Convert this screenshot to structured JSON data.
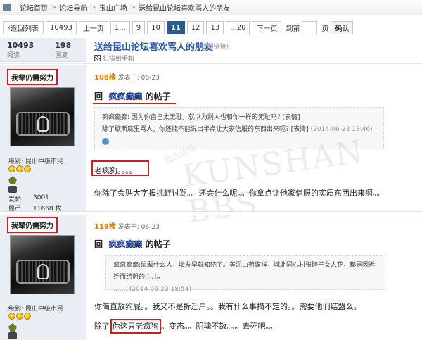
{
  "breadcrumb": {
    "items": [
      "论坛首页",
      "论坛导航",
      "玉山广场",
      "送给昆山论坛喜欢骂人的朋友"
    ],
    "sep": ">"
  },
  "pager": {
    "back": "返回列表",
    "total": "10493",
    "prev": "上一页",
    "pages": [
      "1...",
      "9",
      "10",
      "11",
      "12",
      "13",
      "...20"
    ],
    "current": "11",
    "next": "下一页",
    "jump_label": "到第",
    "page_unit": "页",
    "confirm": "确认"
  },
  "stats": {
    "views": "10493",
    "views_label": "阅读",
    "replies": "198",
    "replies_label": "回复"
  },
  "thread": {
    "title": "送给昆山论坛喜欢骂人的朋友",
    "copy_link": "[复制链接]",
    "scan_mobile": "扫描到手机"
  },
  "post1": {
    "username": "我辈仍需努力",
    "level": "级别: 昆山中级市民",
    "posts_label": "发帖",
    "posts": "3001",
    "coins_label": "昆币",
    "coins": "11668 枚",
    "floor": "108楼",
    "posted": "发表于: 06-23",
    "reply_prefix": "回",
    "quoted_user": "疯疯癫癫",
    "reply_suffix": "的帖子",
    "quote_line1": "疯疯癫癫:    因为你自己太无耻，就以为别人也和你一样的无耻吗? [表情]",
    "quote_line2": "除了歇斯底里骂人，你还能不能说出半点让大家信服的东西出来呢? [表情]",
    "quote_time": "(2014-06-23 18:46)",
    "body1": "老疯狗。。。。",
    "body2": "你除了会贴大字报挑衅讨骂。。还会什么呢。。你拿点让他家信服的实质东西出来啊。。"
  },
  "post2": {
    "username": "我辈仍需努力",
    "level": "级别: 昆山中级市民",
    "floor": "119楼",
    "posted": "发表于: 06-23",
    "reply_prefix": "回",
    "quoted_user": "疯疯癫癫",
    "reply_suffix": "的帖子",
    "quote_line1": "疯疯癫癫:鼠辈什么人，坛友早就知晓了。黄泥山苟谋祥，城北同心村张辟子女人花，都是因拆迁而结盟的主儿。",
    "quote_line2": "....... (2014-06-23 18:54)",
    "body1": "你简直放狗屁。。我又不是拆迁户。。我有什么事摘不定的。。需要他们结盟么。",
    "body2_pre": "除了",
    "body2_box": "你这只老疯狗",
    "body2_post": "。变态。。阴魂不散。。。去死吧。。"
  },
  "watermark": "KUNSHAN BBS",
  "watermark_small": "昆山论坛"
}
